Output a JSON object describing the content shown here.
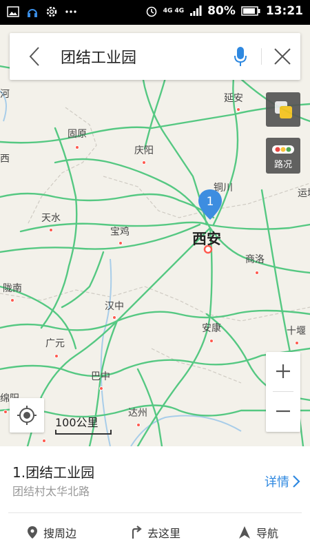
{
  "statusbar": {
    "battery": "80%",
    "time": "13:21",
    "network": "4G 4G"
  },
  "search": {
    "query": "团结工业园"
  },
  "map": {
    "cities": [
      {
        "name": "延安"
      },
      {
        "name": "固原"
      },
      {
        "name": "庆阳"
      },
      {
        "name": "铜川"
      },
      {
        "name": "天水"
      },
      {
        "name": "宝鸡"
      },
      {
        "name": "西安",
        "big": true
      },
      {
        "name": "商洛"
      },
      {
        "name": "陇南"
      },
      {
        "name": "汉中"
      },
      {
        "name": "安康"
      },
      {
        "name": "广元"
      },
      {
        "name": "十堰"
      },
      {
        "name": "巴中"
      },
      {
        "name": "达州"
      },
      {
        "name": "绵阳"
      },
      {
        "name": "运城"
      },
      {
        "name": "西"
      },
      {
        "name": "河"
      }
    ],
    "pin_label": "1",
    "traffic_label": "路况",
    "scale_label": "100公里",
    "colors": {
      "road": "#4fc67e",
      "highway": "#6fd08f",
      "water": "#9ec9ea",
      "border": "#c9c5bd"
    }
  },
  "result": {
    "title": "1.团结工业园",
    "address": "团结村太华北路",
    "detail_label": "详情"
  },
  "actions": {
    "nearby": "搜周边",
    "go_here": "去这里",
    "navigate": "导航"
  }
}
